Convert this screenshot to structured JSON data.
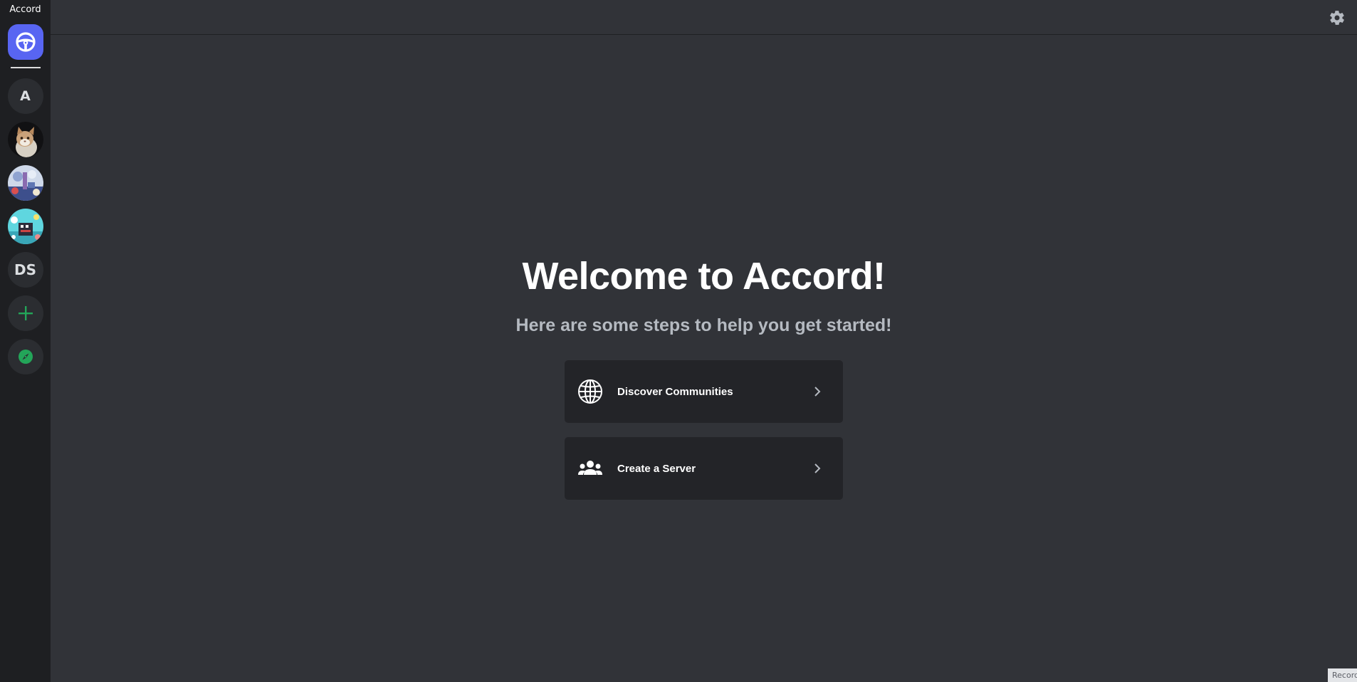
{
  "app": {
    "title": "Accord"
  },
  "sidebar": {
    "home_icon": "steering-wheel-icon",
    "servers": [
      {
        "type": "initials",
        "label": "A"
      },
      {
        "type": "image",
        "icon": "cat-avatar"
      },
      {
        "type": "image",
        "icon": "art-avatar"
      },
      {
        "type": "image",
        "icon": "city-avatar"
      },
      {
        "type": "initials",
        "label": "DS"
      }
    ],
    "add_server_icon": "plus-icon",
    "explore_icon": "compass-icon"
  },
  "topbar": {
    "settings_icon": "gear-icon"
  },
  "welcome": {
    "title": "Welcome to Accord!",
    "subtitle": "Here are some steps to help you get started!"
  },
  "actions": [
    {
      "label": "Discover Communities",
      "icon": "globe-icon"
    },
    {
      "label": "Create a Server",
      "icon": "group-icon"
    }
  ],
  "footer": {
    "record_label": "Record"
  },
  "colors": {
    "sidebar_bg": "#1e1f22",
    "main_bg": "#313338",
    "accent": "#5865f2",
    "green": "#23a559",
    "card_bg": "#232428"
  }
}
